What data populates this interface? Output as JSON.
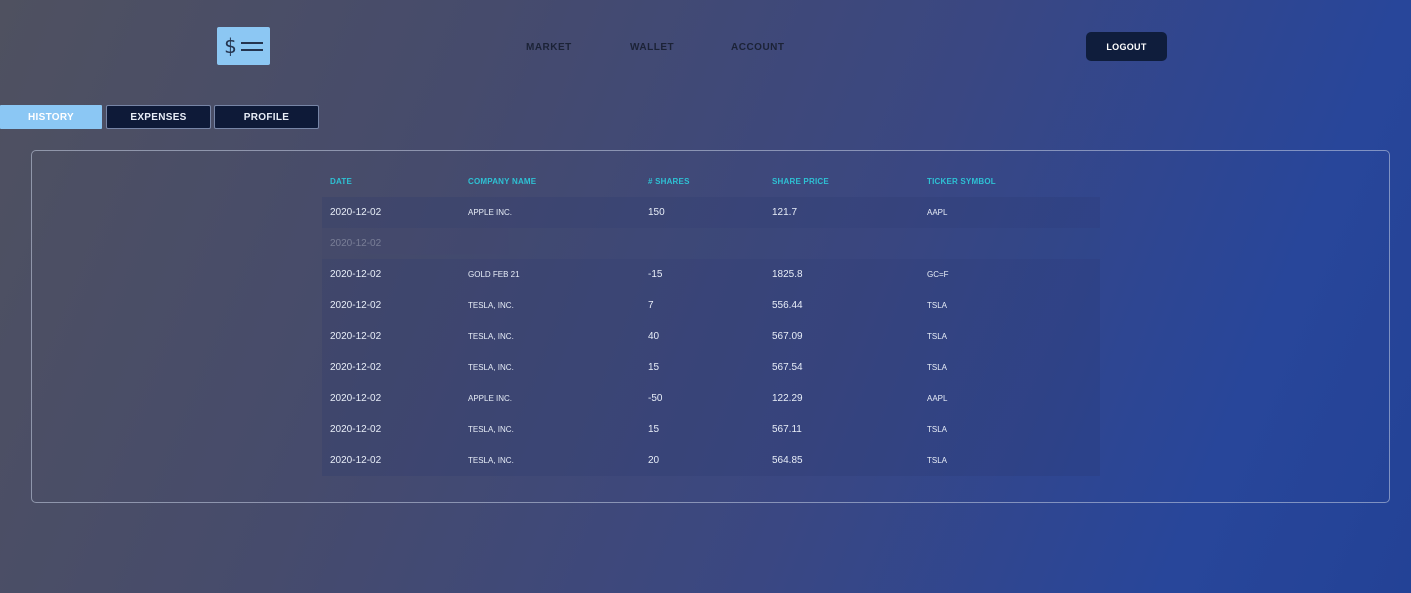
{
  "header": {
    "logo_symbol": "$",
    "nav": [
      "MARKET",
      "WALLET",
      "ACCOUNT"
    ],
    "logout_label": "LOGOUT"
  },
  "tabs": [
    {
      "label": "HISTORY",
      "active": true
    },
    {
      "label": "EXPENSES",
      "active": false
    },
    {
      "label": "PROFILE",
      "active": false
    }
  ],
  "table": {
    "columns": [
      "DATE",
      "COMPANY NAME",
      "# SHARES",
      "SHARE PRICE",
      "TICKER SYMBOL"
    ],
    "rows": [
      {
        "date": "2020-12-02",
        "company": "APPLE INC.",
        "shares": "150",
        "price": "121.7",
        "ticker": "AAPL",
        "faded": false
      },
      {
        "date": "2020-12-02",
        "company": "",
        "shares": "",
        "price": "",
        "ticker": "",
        "faded": true
      },
      {
        "date": "2020-12-02",
        "company": "GOLD FEB 21",
        "shares": "-15",
        "price": "1825.8",
        "ticker": "GC=F",
        "faded": false
      },
      {
        "date": "2020-12-02",
        "company": "TESLA, INC.",
        "shares": "7",
        "price": "556.44",
        "ticker": "TSLA",
        "faded": false
      },
      {
        "date": "2020-12-02",
        "company": "TESLA, INC.",
        "shares": "40",
        "price": "567.09",
        "ticker": "TSLA",
        "faded": false
      },
      {
        "date": "2020-12-02",
        "company": "TESLA, INC.",
        "shares": "15",
        "price": "567.54",
        "ticker": "TSLA",
        "faded": false
      },
      {
        "date": "2020-12-02",
        "company": "APPLE INC.",
        "shares": "-50",
        "price": "122.29",
        "ticker": "AAPL",
        "faded": false
      },
      {
        "date": "2020-12-02",
        "company": "TESLA, INC.",
        "shares": "15",
        "price": "567.11",
        "ticker": "TSLA",
        "faded": false
      },
      {
        "date": "2020-12-02",
        "company": "TESLA, INC.",
        "shares": "20",
        "price": "564.85",
        "ticker": "TSLA",
        "faded": false
      }
    ]
  },
  "colors": {
    "accent": "#8cc7f3",
    "header_text": "#2ec1d4",
    "button_dark": "#0f1d3c"
  },
  "icons": {
    "logo": "dollar-bill-icon"
  }
}
